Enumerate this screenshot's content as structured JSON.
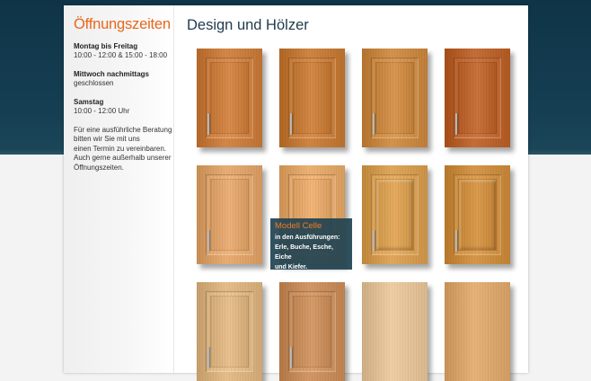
{
  "sidebar": {
    "title": "Öffnungszeiten",
    "hours": [
      {
        "label": "Montag bis Freitag",
        "value": "10:00 - 12:00 & 15:00 - 18:00"
      },
      {
        "label": "Mittwoch nachmittags",
        "value": "geschlossen"
      },
      {
        "label": "Samstag",
        "value": "10:00 - 12:00 Uhr"
      }
    ],
    "note_lines": [
      "Für eine ausführliche Beratung",
      "bitten wir Sie mit uns",
      "einen Termin zu vereinbaren.",
      "Auch gerne außerhalb unserer",
      "Öffnungszeiten."
    ]
  },
  "main": {
    "title": "Design und Hölzer"
  },
  "doors": [
    {
      "style": "shaker",
      "wood_color": "#c77a3a",
      "has_handle": true
    },
    {
      "style": "shaker",
      "wood_color": "#c27835",
      "has_handle": true
    },
    {
      "style": "shaker",
      "wood_color": "#c78640",
      "has_handle": true
    },
    {
      "style": "shaker",
      "wood_color": "#b8602a",
      "has_handle": true
    },
    {
      "style": "shaker",
      "wood_color": "#dba067",
      "has_handle": true
    },
    {
      "style": "shaker",
      "wood_color": "#e0a466",
      "has_handle": false
    },
    {
      "style": "raised",
      "wood_color": "#d39a4e",
      "has_handle": true
    },
    {
      "style": "raised",
      "wood_color": "#c98a3c",
      "has_handle": true
    },
    {
      "style": "shaker",
      "wood_color": "#d8b07d",
      "has_handle": true
    },
    {
      "style": "shaker",
      "wood_color": "#c58a58",
      "has_handle": true
    },
    {
      "style": "flat",
      "wood_color": "#e1c096",
      "has_handle": false
    },
    {
      "style": "flat",
      "wood_color": "#d9a56b",
      "has_handle": false
    }
  ],
  "tooltip": {
    "title": "Modell Celle",
    "subtitle": "in den Ausführungen:",
    "body_line1": "Erle, Buche, Esche, Eiche",
    "body_line2": "und Kiefer."
  }
}
